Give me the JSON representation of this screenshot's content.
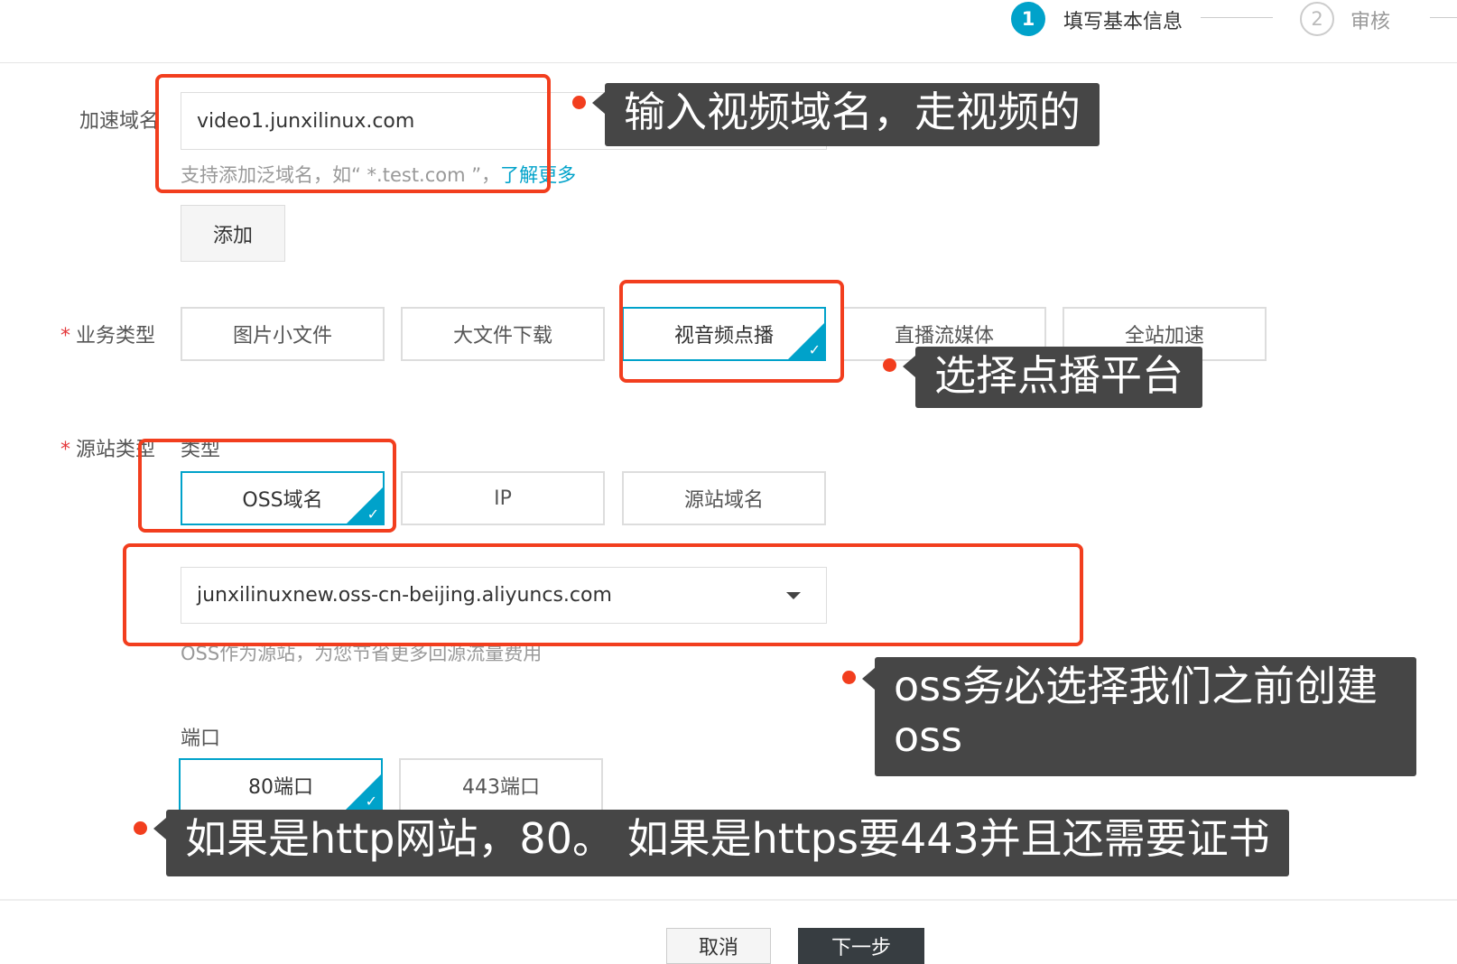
{
  "steps": [
    {
      "number": "1",
      "label": "填写基本信息"
    },
    {
      "number": "2",
      "label": "审核"
    }
  ],
  "form": {
    "domain": {
      "label": "加速域名",
      "value": "video1.junxilinux.com",
      "hint": "支持添加泛域名，如“ *.test.com ”，",
      "hint_link": "了解更多",
      "add_button": "添加"
    },
    "business_type": {
      "label": "业务类型",
      "options": [
        "图片小文件",
        "大文件下载",
        "视音频点播",
        "直播流媒体",
        "全站加速"
      ],
      "selected": "视音频点播"
    },
    "origin_type": {
      "label": "源站类型",
      "sub_label": "类型",
      "options": [
        "OSS域名",
        "IP",
        "源站域名"
      ],
      "selected": "OSS域名"
    },
    "origin_select": {
      "value": "junxilinuxnew.oss-cn-beijing.aliyuncs.com",
      "hint": "OSS作为源站，为您节省更多回源流量费用"
    },
    "port": {
      "label": "端口",
      "options": [
        "80端口",
        "443端口"
      ],
      "selected": "80端口"
    }
  },
  "footer": {
    "cancel": "取消",
    "next": "下一步"
  },
  "annotations": {
    "domain_note": "输入视频域名，走视频的",
    "business_note": "选择点播平台",
    "oss_note_line1": "oss务必选择我们之前创建",
    "oss_note_line2": "oss",
    "port_note": "如果是http网站，80。 如果是https要443并且还需要证书"
  },
  "colors": {
    "accent": "#00a2ca",
    "annotation_red": "#f23e1e",
    "note_bg": "#464646",
    "required": "#e4393c"
  }
}
